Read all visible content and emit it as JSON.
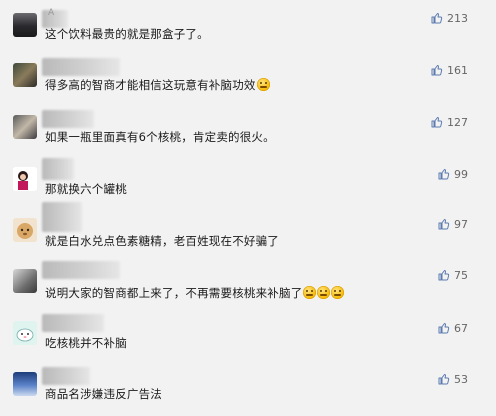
{
  "comments": [
    {
      "nickname": "A",
      "text": "这个饮料最贵的就是那盒子了。",
      "likes": "213",
      "emoji_count": 0
    },
    {
      "nickname": "",
      "text": "得多高的智商才能相信这玩意有补脑功效",
      "likes": "161",
      "emoji_count": 1
    },
    {
      "nickname": "",
      "text": "如果一瓶里面真有6个核桃，肯定卖的很火。",
      "likes": "127",
      "emoji_count": 0
    },
    {
      "nickname": "",
      "text": "那就换六个罐桃",
      "likes": "99",
      "emoji_count": 0
    },
    {
      "nickname": "",
      "text": "就是白水兑点色素糖精，老百姓现在不好骗了",
      "likes": "97",
      "emoji_count": 0
    },
    {
      "nickname": "",
      "text": "说明大家的智商都上来了，不再需要核桃来补脑了",
      "likes": "75",
      "emoji_count": 3
    },
    {
      "nickname": "",
      "text": "吃核桃并不补脑",
      "likes": "67",
      "emoji_count": 0
    },
    {
      "nickname": "",
      "text": "商品名涉嫌违反广告法",
      "likes": "53",
      "emoji_count": 0
    }
  ],
  "icons": {
    "like": "thumbs-up-icon",
    "emoji": "grimace-emoji-icon"
  },
  "colors": {
    "background": "#f2f2f2",
    "like_icon": "#5b7bb0",
    "text": "#1a1a1a",
    "count": "#666666"
  }
}
